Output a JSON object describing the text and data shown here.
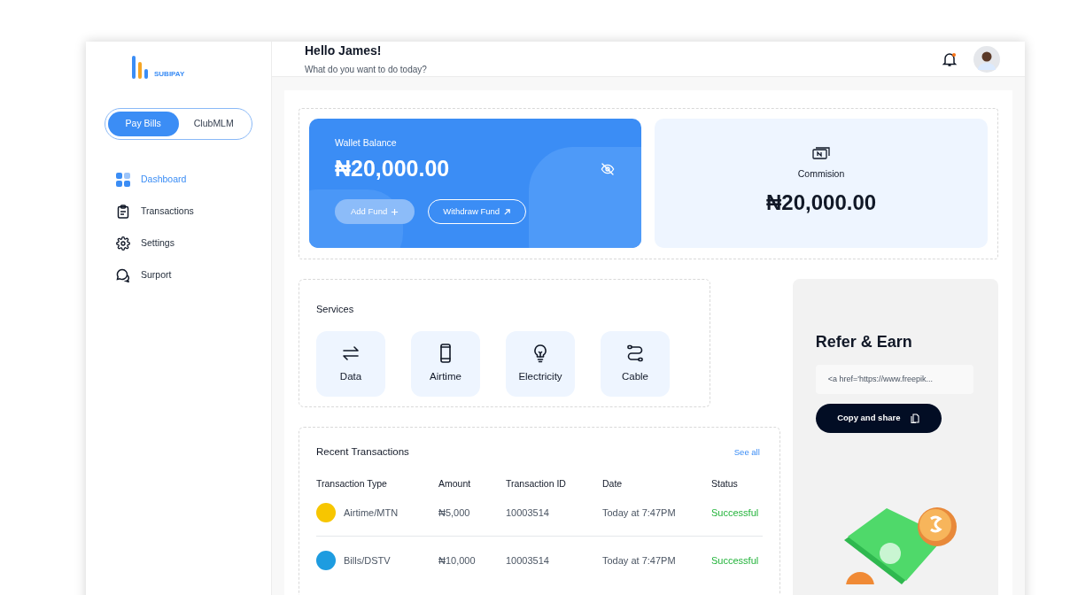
{
  "brand": {
    "name": "SUBIPAY"
  },
  "mode_toggle": [
    {
      "label": "Pay Bills",
      "selected": true
    },
    {
      "label": "ClubMLM",
      "selected": false
    }
  ],
  "nav": [
    {
      "label": "Dashboard",
      "selected": true
    },
    {
      "label": "Transactions",
      "selected": false
    },
    {
      "label": "Settings",
      "selected": false
    },
    {
      "label": "Surport",
      "selected": false
    }
  ],
  "header": {
    "greeting": "Hello James!",
    "subtitle": "What do you want to do today?",
    "unread": true
  },
  "wallet": {
    "label": "Wallet Balance",
    "amount": "₦20,000.00",
    "buttons": [
      {
        "label": "Add Fund",
        "kind": "filled"
      },
      {
        "label": "Withdraw Fund",
        "kind": "outline"
      }
    ]
  },
  "commission": {
    "label": "Commision",
    "amount": "₦20,000.00"
  },
  "services": {
    "title": "Services",
    "items": [
      {
        "label": "Data"
      },
      {
        "label": "Airtime"
      },
      {
        "label": "Electricity"
      },
      {
        "label": "Cable"
      }
    ]
  },
  "transactions": {
    "title": "Recent Transactions",
    "link": "See all",
    "columns": [
      "Transaction Type",
      "Amount",
      "Transaction ID",
      "Date",
      "Status"
    ],
    "rows": [
      {
        "type": "Airtime/MTN",
        "color": "#f7c600",
        "amount": "₦5,000",
        "id": "10003514",
        "date": "Today at 7:47PM",
        "status": "Successful"
      },
      {
        "type": "Bills/DSTV",
        "color": "#1e9ce0",
        "amount": "₦10,000",
        "id": "10003514",
        "date": "Today at 7:47PM",
        "status": "Successful"
      }
    ]
  },
  "refer": {
    "title": "Refer & Earn",
    "link_value": "<a href='https://www.freepik...",
    "button": "Copy and share"
  }
}
